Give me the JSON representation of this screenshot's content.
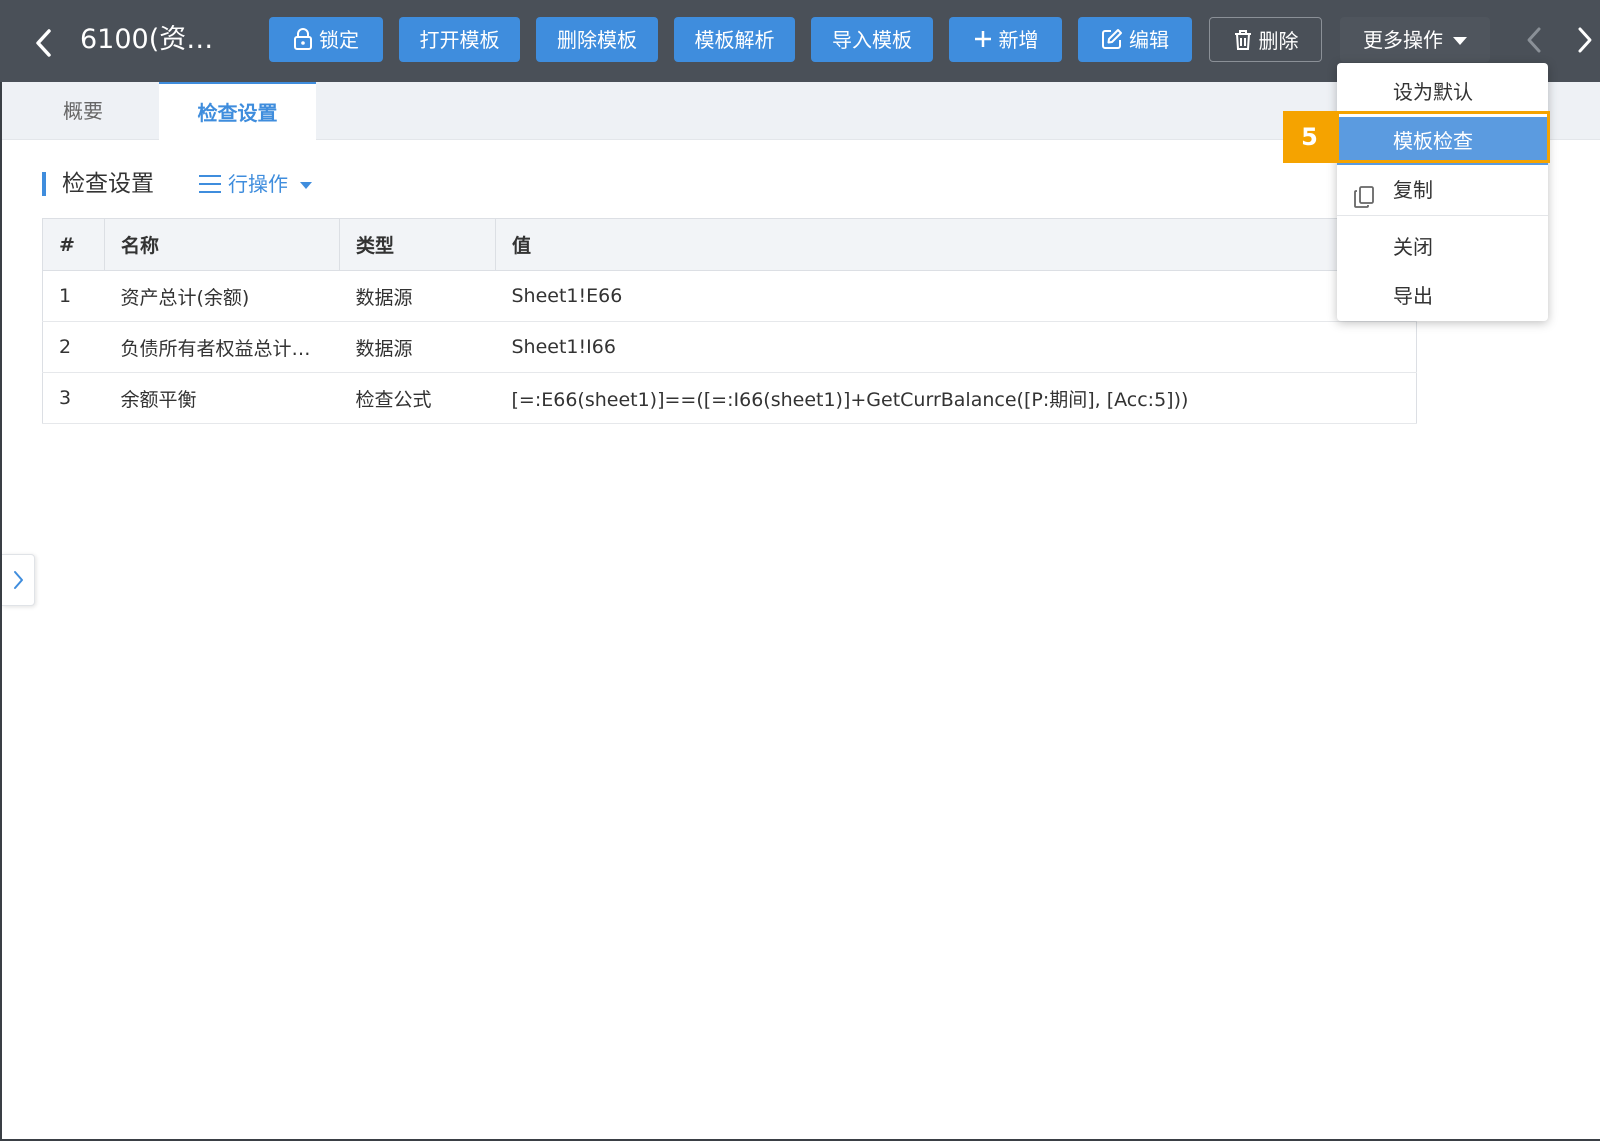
{
  "header": {
    "back_icon": "chevron-left-icon",
    "title": "6100(资…",
    "buttons": {
      "lock": {
        "label": "锁定",
        "icon": "lock-icon"
      },
      "open_template": {
        "label": "打开模板"
      },
      "delete_template": {
        "label": "删除模板"
      },
      "parse_template": {
        "label": "模板解析"
      },
      "import_template": {
        "label": "导入模板"
      },
      "add": {
        "label": "新增",
        "icon": "plus-icon"
      },
      "edit": {
        "label": "编辑",
        "icon": "edit-icon"
      },
      "delete": {
        "label": "删除",
        "icon": "trash-icon"
      },
      "more": {
        "label": "更多操作",
        "icon": "caret-down-icon"
      }
    },
    "prev_icon": "chevron-left-icon",
    "next_icon": "chevron-right-icon"
  },
  "tabs": [
    {
      "label": "概要",
      "active": false
    },
    {
      "label": "检查设置",
      "active": true
    }
  ],
  "section": {
    "title": "检查设置",
    "row_ops_label": "行操作"
  },
  "table": {
    "columns": [
      "#",
      "名称",
      "类型",
      "值"
    ],
    "rows": [
      [
        "1",
        "资产总计(余额)",
        "数据源",
        "Sheet1!E66"
      ],
      [
        "2",
        "负债所有者权益总计…",
        "数据源",
        "Sheet1!I66"
      ],
      [
        "3",
        "余额平衡",
        "检查公式",
        "[=:E66(sheet1)]==([=:I66(sheet1)]+GetCurrBalance([P:期间], [Acc:5]))"
      ]
    ]
  },
  "dropdown": {
    "items": [
      {
        "label": "设为默认",
        "highlighted": false
      },
      {
        "label": "模板检查",
        "highlighted": true
      },
      {
        "label": "复制",
        "icon": "copy-icon",
        "highlighted": false
      },
      {
        "label": "关闭",
        "highlighted": false
      },
      {
        "label": "导出",
        "highlighted": false
      }
    ]
  },
  "annotation": {
    "step": "5"
  },
  "colors": {
    "toolbar_bg": "#4a5058",
    "primary": "#3f8ddd",
    "highlight_item": "#5b9be0",
    "annotation": "#f5a300"
  }
}
